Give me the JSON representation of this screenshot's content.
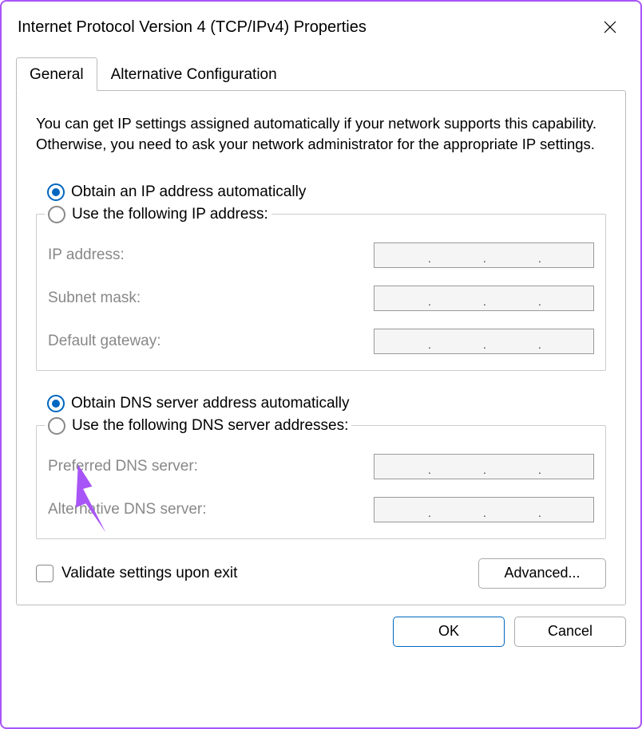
{
  "window": {
    "title": "Internet Protocol Version 4 (TCP/IPv4) Properties"
  },
  "tabs": {
    "general": "General",
    "alternative": "Alternative Configuration"
  },
  "intro": "You can get IP settings assigned automatically if your network supports this capability. Otherwise, you need to ask your network administrator for the appropriate IP settings.",
  "ip_radio": {
    "auto": "Obtain an IP address automatically",
    "manual": "Use the following IP address:"
  },
  "ip_fields": {
    "address": "IP address:",
    "mask": "Subnet mask:",
    "gateway": "Default gateway:"
  },
  "dns_radio": {
    "auto": "Obtain DNS server address automatically",
    "manual": "Use the following DNS server addresses:"
  },
  "dns_fields": {
    "preferred": "Preferred DNS server:",
    "alternative": "Alternative DNS server:"
  },
  "validate": "Validate settings upon exit",
  "advanced": "Advanced...",
  "buttons": {
    "ok": "OK",
    "cancel": "Cancel"
  },
  "states": {
    "ip_mode": "auto",
    "dns_mode": "auto",
    "validate_checked": false
  },
  "annotation": {
    "arrow_color": "#a855f7"
  }
}
